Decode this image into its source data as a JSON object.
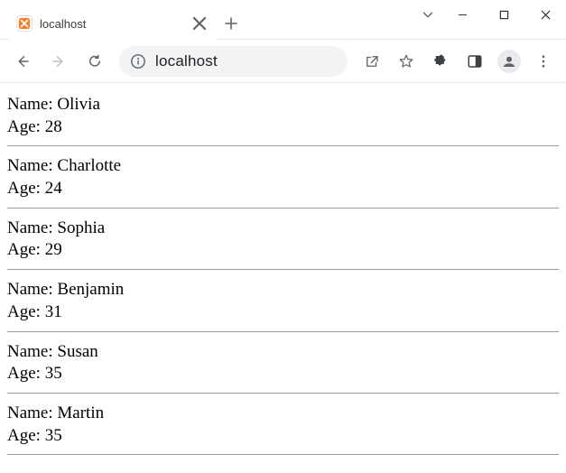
{
  "window": {
    "tab_title": "localhost",
    "address": "localhost"
  },
  "labels": {
    "name_prefix": "Name: ",
    "age_prefix": "Age: "
  },
  "records": [
    {
      "name": "Olivia",
      "age": "28"
    },
    {
      "name": "Charlotte",
      "age": "24"
    },
    {
      "name": "Sophia",
      "age": "29"
    },
    {
      "name": "Benjamin",
      "age": "31"
    },
    {
      "name": "Susan",
      "age": "35"
    },
    {
      "name": "Martin",
      "age": "35"
    }
  ]
}
